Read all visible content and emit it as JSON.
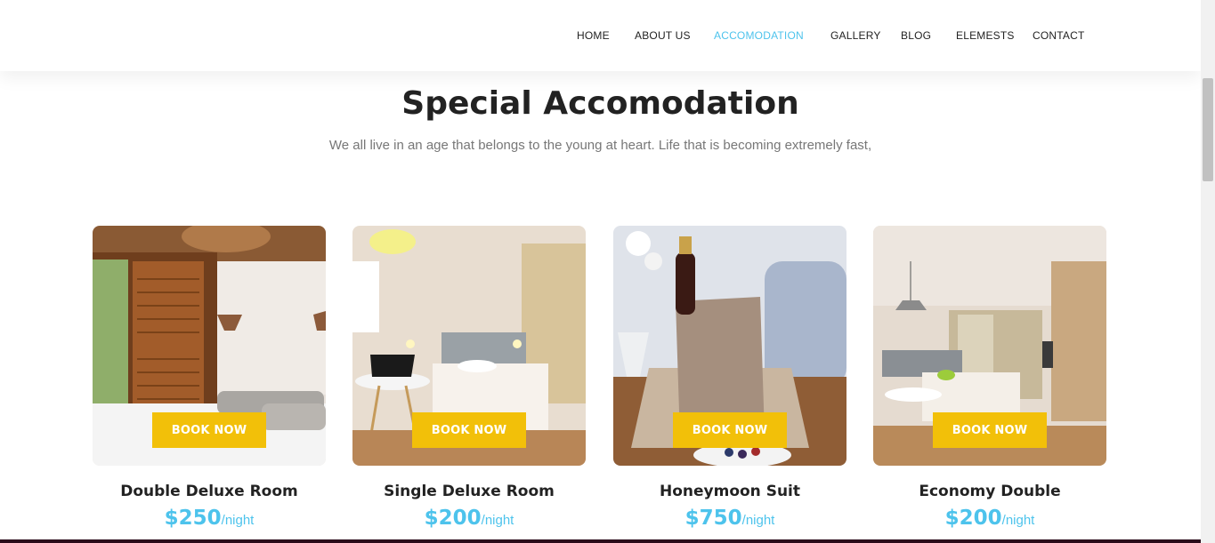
{
  "nav": {
    "items": [
      "HOME",
      "ABOUT US",
      "ACCOMODATION",
      "GALLERY",
      "BLOG",
      "ELEMESTS",
      "CONTACT"
    ],
    "active": "ACCOMODATION"
  },
  "section": {
    "title": "Special Accomodation",
    "subtitle": "We all live in an age that belongs to the young at heart. Life that is becoming extremely fast,"
  },
  "rooms": [
    {
      "name": "Double Deluxe Room",
      "price": "$250",
      "per": "/night",
      "button": "BOOK NOW"
    },
    {
      "name": "Single Deluxe Room",
      "price": "$200",
      "per": "/night",
      "button": "BOOK NOW"
    },
    {
      "name": "Honeymoon Suit",
      "price": "$750",
      "per": "/night",
      "button": "BOOK NOW"
    },
    {
      "name": "Economy Double",
      "price": "$200",
      "per": "/night",
      "button": "BOOK NOW"
    }
  ],
  "colors": {
    "accent": "#4dc3ec",
    "button": "#f2c009"
  }
}
